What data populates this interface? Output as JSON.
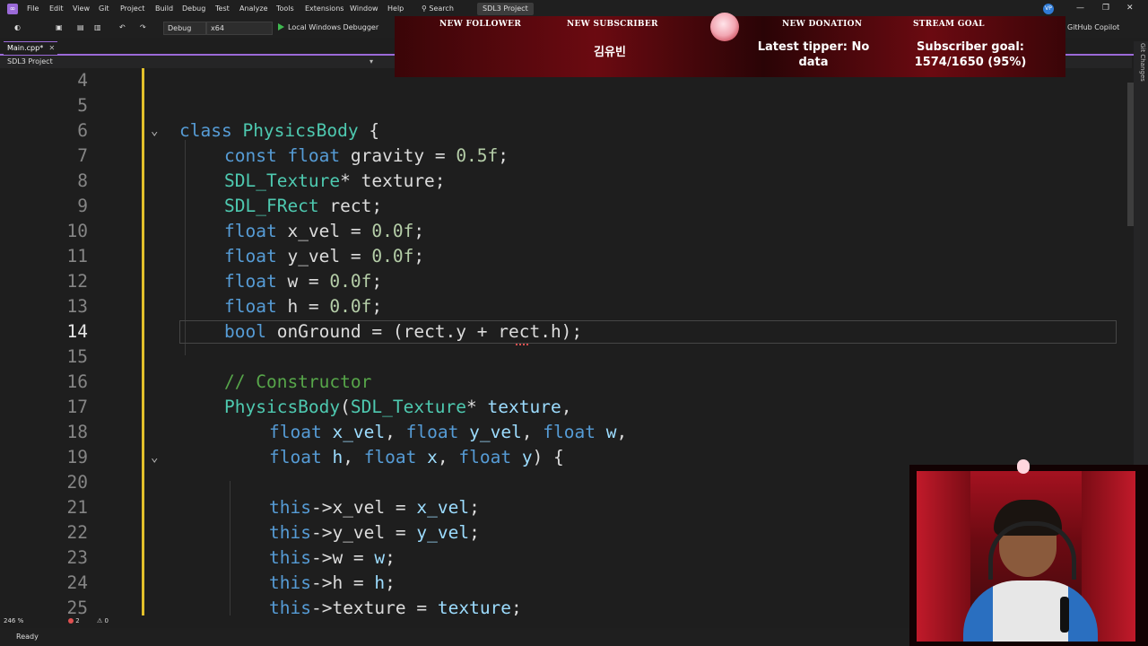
{
  "menu": [
    "File",
    "Edit",
    "View",
    "Git",
    "Project",
    "Build",
    "Debug",
    "Test",
    "Analyze",
    "Tools",
    "Extensions",
    "Window",
    "Help"
  ],
  "search_label": "Search",
  "project_name": "SDL3 Project",
  "window_controls": [
    "—",
    "❐",
    "✕"
  ],
  "user_initials": "VP",
  "toolbar": {
    "config": "Debug",
    "platform": "x64",
    "debugger": "Local Windows Debugger",
    "copilot": "GitHub Copilot"
  },
  "tab": {
    "label": "Main.cpp*",
    "close": "✕"
  },
  "nav": {
    "scope": "SDL3 Project"
  },
  "overlay": {
    "headers": [
      "NEW FOLLOWER",
      "NEW SUBSCRIBER",
      "NEW DONATION",
      "STREAM GOAL"
    ],
    "follower": "김유빈",
    "tipper": "Latest tipper: No data",
    "goal": "Subscriber goal: 1574/1650 (95%)"
  },
  "code": {
    "current_line": 14,
    "lines": [
      {
        "n": 4
      },
      {
        "n": 5
      },
      {
        "n": 6
      },
      {
        "n": 7
      },
      {
        "n": 8
      },
      {
        "n": 9
      },
      {
        "n": 10
      },
      {
        "n": 11
      },
      {
        "n": 12
      },
      {
        "n": 13
      },
      {
        "n": 14
      },
      {
        "n": 15
      },
      {
        "n": 16
      },
      {
        "n": 17
      },
      {
        "n": 18
      },
      {
        "n": 19
      },
      {
        "n": 20
      },
      {
        "n": 21
      },
      {
        "n": 22
      },
      {
        "n": 23
      },
      {
        "n": 24
      },
      {
        "n": 25
      }
    ],
    "tokens": {
      "l6": [
        [
          "kw",
          "class "
        ],
        [
          "ty",
          "PhysicsBody"
        ],
        [
          "br",
          " {"
        ]
      ],
      "l7": [
        [
          "kw",
          "const "
        ],
        [
          "kw",
          "float "
        ],
        [
          "",
          "gravity = "
        ],
        [
          "num",
          "0.5f"
        ],
        [
          "",
          ";"
        ]
      ],
      "l8": [
        [
          "ty",
          "SDL_Texture"
        ],
        [
          "",
          "* texture;"
        ]
      ],
      "l9": [
        [
          "ty",
          "SDL_FRect"
        ],
        [
          "",
          " rect;"
        ]
      ],
      "l10": [
        [
          "kw",
          "float "
        ],
        [
          "",
          "x_vel = "
        ],
        [
          "num",
          "0.0f"
        ],
        [
          "",
          ";"
        ]
      ],
      "l11": [
        [
          "kw",
          "float "
        ],
        [
          "",
          "y_vel = "
        ],
        [
          "num",
          "0.0f"
        ],
        [
          "",
          ";"
        ]
      ],
      "l12": [
        [
          "kw",
          "float "
        ],
        [
          "",
          "w = "
        ],
        [
          "num",
          "0.0f"
        ],
        [
          "",
          ";"
        ]
      ],
      "l13": [
        [
          "kw",
          "float "
        ],
        [
          "",
          "h = "
        ],
        [
          "num",
          "0.0f"
        ],
        [
          "",
          ";"
        ]
      ],
      "l14": [
        [
          "kw",
          "bool "
        ],
        [
          "",
          "onGround = (rect.y + rect.h);"
        ]
      ],
      "l16": [
        [
          "cm",
          "// Constructor"
        ]
      ],
      "l17": [
        [
          "ty",
          "PhysicsBody"
        ],
        [
          "",
          "("
        ],
        [
          "ty",
          "SDL_Texture"
        ],
        [
          "",
          "* "
        ],
        [
          "pm",
          "texture"
        ],
        [
          "",
          ","
        ]
      ],
      "l18": [
        [
          "kw",
          "float "
        ],
        [
          "pm",
          "x_vel"
        ],
        [
          "",
          ", "
        ],
        [
          "kw",
          "float "
        ],
        [
          "pm",
          "y_vel"
        ],
        [
          "",
          ", "
        ],
        [
          "kw",
          "float "
        ],
        [
          "pm",
          "w"
        ],
        [
          "",
          ","
        ]
      ],
      "l19": [
        [
          "kw",
          "float "
        ],
        [
          "pm",
          "h"
        ],
        [
          "",
          ", "
        ],
        [
          "kw",
          "float "
        ],
        [
          "pm",
          "x"
        ],
        [
          "",
          ", "
        ],
        [
          "kw",
          "float "
        ],
        [
          "pm",
          "y"
        ],
        [
          "",
          ") {"
        ]
      ],
      "l21": [
        [
          "kw",
          "this"
        ],
        [
          "",
          "->x_vel = "
        ],
        [
          "pm",
          "x_vel"
        ],
        [
          "",
          ";"
        ]
      ],
      "l22": [
        [
          "kw",
          "this"
        ],
        [
          "",
          "->y_vel = "
        ],
        [
          "pm",
          "y_vel"
        ],
        [
          "",
          ";"
        ]
      ],
      "l23": [
        [
          "kw",
          "this"
        ],
        [
          "",
          "->w = "
        ],
        [
          "pm",
          "w"
        ],
        [
          "",
          ";"
        ]
      ],
      "l24": [
        [
          "kw",
          "this"
        ],
        [
          "",
          "->h = "
        ],
        [
          "pm",
          "h"
        ],
        [
          "",
          ";"
        ]
      ],
      "l25": [
        [
          "kw",
          "this"
        ],
        [
          "",
          "->texture = "
        ],
        [
          "pm",
          "texture"
        ],
        [
          "",
          ";"
        ]
      ]
    }
  },
  "status": {
    "zoom": "246 %",
    "errors": "2",
    "warnings": "0",
    "ready": "Ready"
  },
  "side_label": "Git Changes",
  "colors": {
    "accent": "#9b6ad8",
    "margin": "#e2c02a",
    "overlay": "#6b0a11"
  }
}
